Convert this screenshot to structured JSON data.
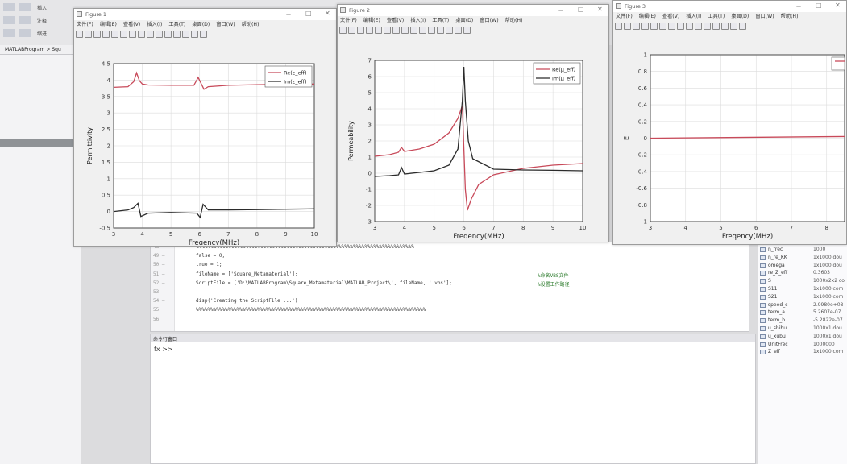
{
  "matlab": {
    "toolbar_labels": [
      "插入",
      "注释",
      "缩进"
    ],
    "path_text": "MATLABProgram > Squ",
    "editor_lines": [
      {
        "num": "48",
        "code": "%%%%%%%%%%%%%%%%%%%%%%%%%%%%%%%%%%%%%%%%%%%%%%%%%%%%%%%%%%%%%%%%%%%%%%%%%%%",
        "comment": ""
      },
      {
        "num": "49 —",
        "code": "false = 0;",
        "comment": ""
      },
      {
        "num": "50 —",
        "code": "true = 1;",
        "comment": ""
      },
      {
        "num": "51 —",
        "code": "fileName = ['Square_Metamaterial'];",
        "comment": "%命名VBS文件"
      },
      {
        "num": "52 —",
        "code": "ScriptFile = ['D:\\MATLABProgram\\Square_Metamaterial\\MATLAB_Project\\', fileName, '.vbs'];",
        "comment": "%设置工作路径"
      },
      {
        "num": "53",
        "code": "",
        "comment": ""
      },
      {
        "num": "54 —",
        "code": "disp('Creating the ScriptFile ...')",
        "comment": ""
      },
      {
        "num": "55",
        "code": "%%%%%%%%%%%%%%%%%%%%%%%%%%%%%%%%%%%%%%%%%%%%%%%%%%%%%%%%%%%%%%%%%%%%%%%%%%%%%%%",
        "comment": ""
      },
      {
        "num": "56",
        "code": "",
        "comment": ""
      }
    ],
    "command_window": {
      "title": "命令行窗口",
      "prompt": "fx >>"
    },
    "workspace": [
      {
        "name": "n_frec",
        "value": "1000"
      },
      {
        "name": "n_re_KK",
        "value": "1x1000 dou"
      },
      {
        "name": "omega",
        "value": "1x1000 dou"
      },
      {
        "name": "re_Z_eff",
        "value": "0.3603"
      },
      {
        "name": "S",
        "value": "1000x2x2 co"
      },
      {
        "name": "S11",
        "value": "1x1000 com"
      },
      {
        "name": "S21",
        "value": "1x1000 com"
      },
      {
        "name": "speed_c",
        "value": "2.9980e+08"
      },
      {
        "name": "term_a",
        "value": "5.2607e-07"
      },
      {
        "name": "term_b",
        "value": "-5.2822e-07"
      },
      {
        "name": "u_shibu",
        "value": "1000x1 dou"
      },
      {
        "name": "u_xubu",
        "value": "1000x1 dou"
      },
      {
        "name": "UnitFrec",
        "value": "1000000"
      },
      {
        "name": "Z_eff",
        "value": "1x1000 com"
      }
    ]
  },
  "figure_menu": [
    "文件(F)",
    "编辑(E)",
    "查看(V)",
    "插入(I)",
    "工具(T)",
    "桌面(D)",
    "窗口(W)",
    "帮助(H)"
  ],
  "figures": [
    {
      "title": "Figure 1",
      "xlabel": "Freqency(MHz)",
      "ylabel": "Permittivity",
      "legend": [
        "Re(ε_eff)",
        "Im(ε_eff)"
      ]
    },
    {
      "title": "Figure 2",
      "xlabel": "Freqency(MHz)",
      "ylabel": "Permeability",
      "legend": [
        "Re(μ_eff)",
        "Im(μ_eff)"
      ]
    },
    {
      "title": "Figure 3",
      "xlabel": "Freqency(MHz)",
      "ylabel": "E",
      "legend": []
    }
  ],
  "colors": {
    "re_line": "#c84a5a",
    "im_line": "#2b2b2b"
  },
  "chart_data": [
    {
      "type": "line",
      "xlim": [
        3,
        10
      ],
      "ylim": [
        -0.5,
        4.5
      ],
      "xticks": [
        3,
        4,
        5,
        6,
        7,
        8,
        9,
        10
      ],
      "yticks": [
        -0.5,
        0,
        0.5,
        1,
        1.5,
        2,
        2.5,
        3,
        3.5,
        4,
        4.5
      ],
      "grid": true,
      "legend_position": "top-right",
      "series": [
        {
          "name": "Re(ε_eff)",
          "x": [
            3,
            3.5,
            3.7,
            3.8,
            3.9,
            4.0,
            4.2,
            5.0,
            5.8,
            5.95,
            6.05,
            6.15,
            6.3,
            7.0,
            8.0,
            9.0,
            10.0
          ],
          "y": [
            3.78,
            3.8,
            3.95,
            4.22,
            3.98,
            3.88,
            3.85,
            3.84,
            3.84,
            4.08,
            3.9,
            3.72,
            3.8,
            3.84,
            3.86,
            3.87,
            3.88
          ]
        },
        {
          "name": "Im(ε_eff)",
          "x": [
            3,
            3.5,
            3.7,
            3.85,
            3.95,
            4.2,
            5.0,
            5.9,
            6.02,
            6.12,
            6.3,
            7.0,
            8.0,
            9.0,
            10.0
          ],
          "y": [
            0.0,
            0.05,
            0.12,
            0.25,
            -0.15,
            -0.05,
            -0.03,
            -0.05,
            -0.18,
            0.22,
            0.05,
            0.05,
            0.06,
            0.07,
            0.08
          ]
        }
      ]
    },
    {
      "type": "line",
      "xlim": [
        3,
        10
      ],
      "ylim": [
        -3,
        7
      ],
      "xticks": [
        3,
        4,
        5,
        6,
        7,
        8,
        9,
        10
      ],
      "yticks": [
        -3,
        -2,
        -1,
        0,
        1,
        2,
        3,
        4,
        5,
        6,
        7
      ],
      "grid": true,
      "legend_position": "top-right",
      "series": [
        {
          "name": "Re(μ_eff)",
          "x": [
            3,
            3.5,
            3.8,
            3.9,
            4.0,
            4.5,
            5.0,
            5.5,
            5.8,
            5.95,
            6.05,
            6.12,
            6.25,
            6.5,
            7.0,
            8.0,
            9.0,
            10.0
          ],
          "y": [
            1.05,
            1.15,
            1.3,
            1.6,
            1.35,
            1.5,
            1.8,
            2.5,
            3.4,
            4.2,
            -1.0,
            -2.3,
            -1.6,
            -0.7,
            -0.1,
            0.3,
            0.5,
            0.6
          ]
        },
        {
          "name": "Im(μ_eff)",
          "x": [
            3,
            3.5,
            3.8,
            3.9,
            4.0,
            4.5,
            5.0,
            5.5,
            5.8,
            5.95,
            6.0,
            6.05,
            6.15,
            6.3,
            7.0,
            8.0,
            9.0,
            10.0
          ],
          "y": [
            -0.2,
            -0.15,
            -0.1,
            0.35,
            -0.05,
            0.05,
            0.15,
            0.5,
            1.5,
            4.5,
            6.6,
            4.5,
            2.0,
            0.9,
            0.25,
            0.2,
            0.18,
            0.15
          ]
        }
      ]
    },
    {
      "type": "line",
      "xlim": [
        3,
        8.6
      ],
      "ylim": [
        -1,
        1
      ],
      "xticks": [
        3,
        4,
        5,
        6,
        7,
        8
      ],
      "yticks": [
        -1,
        -0.8,
        -0.6,
        -0.4,
        -0.2,
        0,
        0.2,
        0.4,
        0.6,
        0.8,
        1
      ],
      "grid": true,
      "legend_position": "top-right",
      "series": [
        {
          "name": "",
          "x": [
            3,
            8.6
          ],
          "y": [
            0.0,
            0.02
          ]
        }
      ]
    }
  ]
}
